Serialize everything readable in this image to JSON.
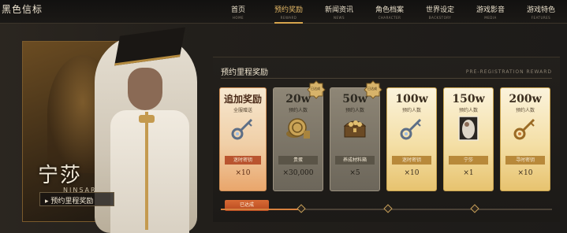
{
  "logo_text": "黑色信标",
  "nav": [
    {
      "zh": "首页",
      "en": "HOME",
      "active": false
    },
    {
      "zh": "预约奖励",
      "en": "REWARD",
      "active": true
    },
    {
      "zh": "新闻资讯",
      "en": "NEWS",
      "active": false
    },
    {
      "zh": "角色档案",
      "en": "CHARACTER",
      "active": false
    },
    {
      "zh": "世界设定",
      "en": "BACKSTORY",
      "active": false
    },
    {
      "zh": "游戏影音",
      "en": "MEDIA",
      "active": false
    },
    {
      "zh": "游戏特色",
      "en": "FEATURES",
      "active": false
    }
  ],
  "hero": {
    "name": "宁莎",
    "name_en": "NINSAR",
    "button": "▸ 预约里程奖励"
  },
  "panel": {
    "title": "预约里程奖励",
    "subtitle": "PRE-REGISTRATION REWARD",
    "progress": 0.24,
    "reached_label": "已达成",
    "badge_label": "已达成"
  },
  "cards": [
    {
      "style": "first",
      "milestone": "追加奖励",
      "desc": "全服赠送",
      "item": "迷时密钥",
      "qty": "×10",
      "icon": "key-icon"
    },
    {
      "style": "grey",
      "milestone": "20w",
      "desc": "预约人数",
      "item": "贵蛋",
      "qty": "×30,000",
      "icon": "coin-stack-icon",
      "badge": true
    },
    {
      "style": "grey",
      "milestone": "50w",
      "desc": "预约人数",
      "item": "养成材料箱",
      "qty": "×5",
      "icon": "treasure-chest-icon",
      "badge": true
    },
    {
      "style": "gold",
      "milestone": "100w",
      "desc": "预约人数",
      "item": "迷时密钥",
      "qty": "×10",
      "icon": "key-icon"
    },
    {
      "style": "gold",
      "milestone": "150w",
      "desc": "预约人数",
      "item": "宁莎",
      "qty": "×1",
      "icon": "character-portrait-icon"
    },
    {
      "style": "gold",
      "milestone": "200w",
      "desc": "预约人数",
      "item": "寻时密钥",
      "qty": "×10",
      "icon": "golden-key-icon"
    }
  ],
  "colors": {
    "accent": "#d6a44d",
    "reached": "#c8582a",
    "gold_card": "#f4dfa6",
    "grey_card": "#7d766a"
  }
}
